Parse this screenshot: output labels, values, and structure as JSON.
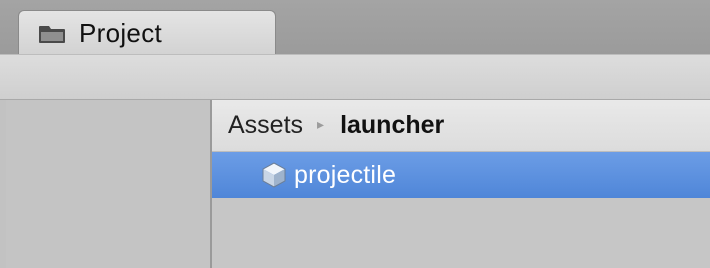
{
  "window": {
    "tab": {
      "label": "Project",
      "icon": "folder-icon"
    }
  },
  "breadcrumb": {
    "root": "Assets",
    "separator": "▸",
    "current": "launcher"
  },
  "assets": {
    "items": [
      {
        "label": "projectile",
        "icon": "prefab-cube-icon",
        "selected": true
      }
    ]
  },
  "colors": {
    "selection": "#5a8fdf",
    "panel": "#c2c2c2"
  }
}
